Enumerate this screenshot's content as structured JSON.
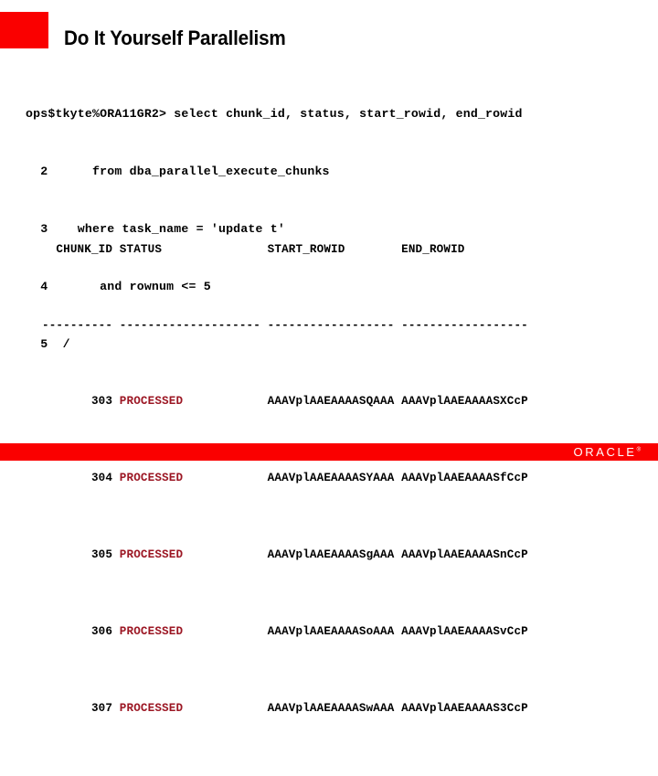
{
  "slide": {
    "title": "Do It Yourself Parallelism",
    "accent_color": "#fa0000",
    "status_color": "#9c1724"
  },
  "console": {
    "lines": [
      "ops$tkyte%ORA11GR2> select chunk_id, status, start_rowid, end_rowid",
      "  2      from dba_parallel_execute_chunks",
      "  3    where task_name = 'update t'",
      "  4       and rownum <= 5",
      "  5  /"
    ]
  },
  "result_table": {
    "headers": [
      "  CHUNK_ID",
      "STATUS              ",
      "START_ROWID       ",
      "END_ROWID         "
    ],
    "rules": [
      "----------",
      "--------------------",
      "------------------",
      "------------------"
    ],
    "rows": [
      {
        "chunk_id": "       303",
        "status": "PROCESSED           ",
        "start_rowid": "AAAVplAAEAAAASQAAA",
        "end_rowid": "AAAVplAAEAAAASXCcP"
      },
      {
        "chunk_id": "       304",
        "status": "PROCESSED           ",
        "start_rowid": "AAAVplAAEAAAASYAAA",
        "end_rowid": "AAAVplAAEAAAASfCcP"
      },
      {
        "chunk_id": "       305",
        "status": "PROCESSED           ",
        "start_rowid": "AAAVplAAEAAAASgAAA",
        "end_rowid": "AAAVplAAEAAAASnCcP"
      },
      {
        "chunk_id": "       306",
        "status": "PROCESSED           ",
        "start_rowid": "AAAVplAAEAAAASoAAA",
        "end_rowid": "AAAVplAAEAAAASvCcP"
      },
      {
        "chunk_id": "       307",
        "status": "PROCESSED           ",
        "start_rowid": "AAAVplAAEAAAASwAAA",
        "end_rowid": "AAAVplAAEAAAAS3CcP"
      }
    ]
  },
  "footer": {
    "brand": "ORACLE",
    "registered_mark": "®"
  }
}
